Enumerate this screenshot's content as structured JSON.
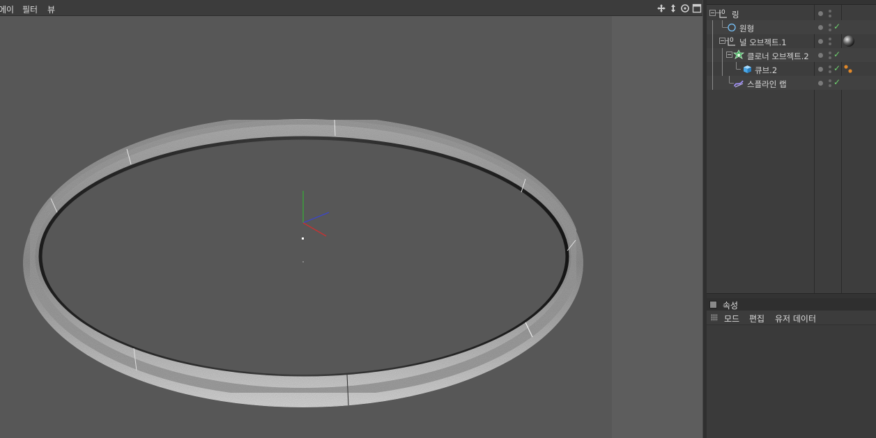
{
  "viewport": {
    "menu": [
      "에이",
      "필터",
      "뷰"
    ],
    "nav_icons": [
      "move-view-icon",
      "dolly-view-icon",
      "rotate-view-icon",
      "maximize-view-icon"
    ]
  },
  "object_manager": {
    "items": [
      {
        "label": "링",
        "icon": "null-object-icon",
        "level": 0
      },
      {
        "label": "원형",
        "icon": "circle-spline-icon",
        "level": 1
      },
      {
        "label": "널 오브젝트.1",
        "icon": "null-object-icon",
        "level": 1
      },
      {
        "label": "클로너 오브젝트.2",
        "icon": "cloner-icon",
        "level": 2
      },
      {
        "label": "큐브.2",
        "icon": "cube-icon",
        "level": 3
      },
      {
        "label": "스플라인 랩",
        "icon": "spline-wrap-icon",
        "level": 2
      }
    ]
  },
  "attributes": {
    "title": "속성",
    "menu": [
      "모드",
      "편집",
      "유저 데이터"
    ]
  },
  "colors": {
    "viewport_bg": "#575757",
    "check": "#6fd36f",
    "axis_y": "#3aa23a",
    "axis_x": "#c83232",
    "axis_z": "#3c46c8"
  }
}
